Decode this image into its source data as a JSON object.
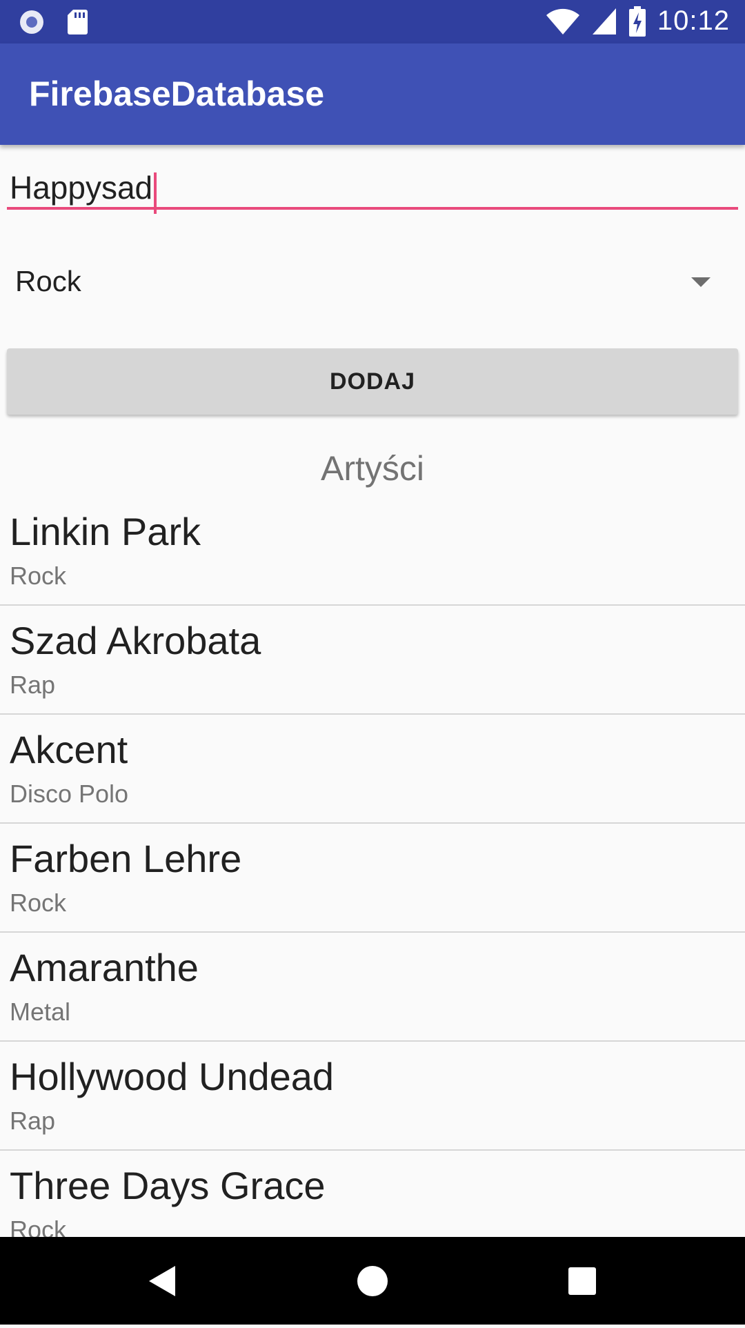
{
  "status_bar": {
    "time": "10:12",
    "icons": [
      "record-icon",
      "sd-card-icon",
      "wifi-icon",
      "signal-icon",
      "battery-charging-icon"
    ]
  },
  "app_bar": {
    "title": "FirebaseDatabase"
  },
  "form": {
    "name_value": "Happysad",
    "genre_selected": "Rock",
    "add_button_label": "DODAJ"
  },
  "list": {
    "title": "Artyści",
    "items": [
      {
        "name": "Linkin Park",
        "genre": "Rock"
      },
      {
        "name": "Szad Akrobata",
        "genre": "Rap"
      },
      {
        "name": "Akcent",
        "genre": "Disco Polo"
      },
      {
        "name": "Farben Lehre",
        "genre": "Rock"
      },
      {
        "name": "Amaranthe",
        "genre": "Metal"
      },
      {
        "name": "Hollywood Undead",
        "genre": "Rap"
      },
      {
        "name": "Three Days Grace",
        "genre": "Rock"
      }
    ]
  },
  "colors": {
    "status_bar": "#303f9f",
    "app_bar": "#3f51b5",
    "accent": "#e94a7c",
    "button": "#d6d6d6"
  },
  "nav_bar": {
    "icons": [
      "back-icon",
      "home-icon",
      "recents-icon"
    ]
  }
}
